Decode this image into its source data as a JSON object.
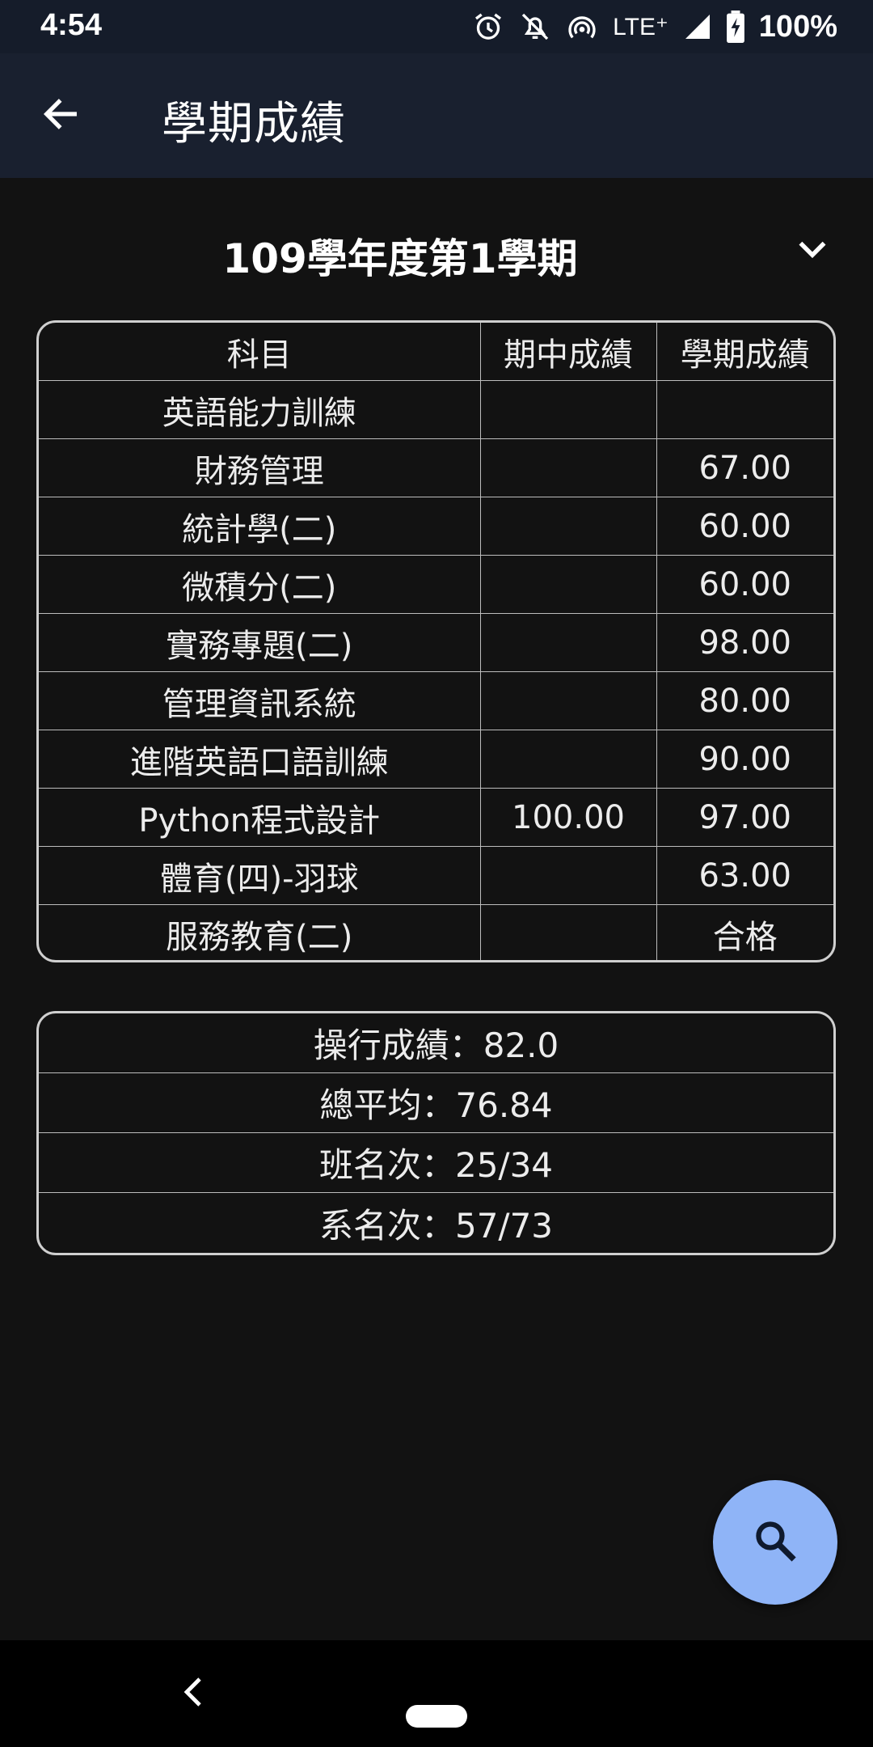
{
  "status_bar": {
    "time": "4:54",
    "network": "LTE⁺",
    "battery": "100%",
    "icons": [
      "alarm-icon",
      "notifications-off-icon",
      "hotspot-icon",
      "signal-icon",
      "battery-charging-icon"
    ]
  },
  "app_bar": {
    "title": "學期成績",
    "back_icon": "arrow-back-icon"
  },
  "semester": {
    "selected": "109學年度第1學期",
    "icon": "chevron-down-icon"
  },
  "grades_table": {
    "headers": [
      "科目",
      "期中成績",
      "學期成績"
    ],
    "rows": [
      {
        "subject": "英語能力訓練",
        "midterm": "",
        "semester": ""
      },
      {
        "subject": "財務管理",
        "midterm": "",
        "semester": "67.00"
      },
      {
        "subject": "統計學(二)",
        "midterm": "",
        "semester": "60.00"
      },
      {
        "subject": "微積分(二)",
        "midterm": "",
        "semester": "60.00"
      },
      {
        "subject": "實務專題(二)",
        "midterm": "",
        "semester": "98.00"
      },
      {
        "subject": "管理資訊系統",
        "midterm": "",
        "semester": "80.00"
      },
      {
        "subject": "進階英語口語訓練",
        "midterm": "",
        "semester": "90.00"
      },
      {
        "subject": "Python程式設計",
        "midterm": "100.00",
        "semester": "97.00"
      },
      {
        "subject": "體育(四)-羽球",
        "midterm": "",
        "semester": "63.00"
      },
      {
        "subject": "服務教育(二)",
        "midterm": "",
        "semester": "合格"
      }
    ]
  },
  "summary": {
    "conduct": "操行成績：82.0",
    "average": "總平均：76.84",
    "class_rank": "班名次：25/34",
    "dept_rank": "系名次：57/73"
  },
  "fab": {
    "icon": "search-icon"
  },
  "nav_bar": {
    "icons": [
      "nav-back-icon",
      "home-pill-icon"
    ]
  },
  "colors": {
    "background": "#121212",
    "app_bar": "#19202f",
    "fab": "#8fb4f7",
    "border": "#cfcfcf"
  }
}
